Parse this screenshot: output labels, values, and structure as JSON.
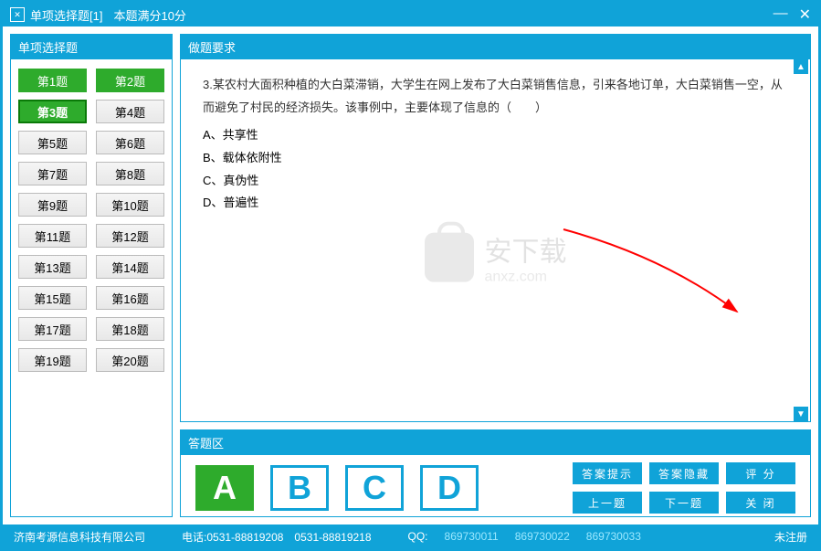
{
  "window": {
    "title": "单项选择题[1]",
    "score_label": "本题满分10分"
  },
  "sidebar": {
    "header": "单项选择题",
    "questions": [
      {
        "label": "第1题",
        "state": "done"
      },
      {
        "label": "第2题",
        "state": "done"
      },
      {
        "label": "第3题",
        "state": "current"
      },
      {
        "label": "第4题",
        "state": ""
      },
      {
        "label": "第5题",
        "state": ""
      },
      {
        "label": "第6题",
        "state": ""
      },
      {
        "label": "第7题",
        "state": ""
      },
      {
        "label": "第8题",
        "state": ""
      },
      {
        "label": "第9题",
        "state": ""
      },
      {
        "label": "第10题",
        "state": ""
      },
      {
        "label": "第11题",
        "state": ""
      },
      {
        "label": "第12题",
        "state": ""
      },
      {
        "label": "第13题",
        "state": ""
      },
      {
        "label": "第14题",
        "state": ""
      },
      {
        "label": "第15题",
        "state": ""
      },
      {
        "label": "第16题",
        "state": ""
      },
      {
        "label": "第17题",
        "state": ""
      },
      {
        "label": "第18题",
        "state": ""
      },
      {
        "label": "第19题",
        "state": ""
      },
      {
        "label": "第20题",
        "state": ""
      }
    ]
  },
  "question": {
    "header": "做题要求",
    "text": "3.某农村大面积种植的大白菜滞销，大学生在网上发布了大白菜销售信息，引来各地订单，大白菜销售一空，从而避免了村民的经济损失。该事例中，主要体现了信息的（　　）",
    "options": {
      "A": "A、共享性",
      "B": "B、载体依附性",
      "C": "C、真伪性",
      "D": "D、普遍性"
    }
  },
  "watermark": {
    "main": "安下载",
    "sub": "anxz.com"
  },
  "answer": {
    "header": "答题区",
    "choices": [
      "A",
      "B",
      "C",
      "D"
    ],
    "selected": "A",
    "actions": {
      "hint": "答案提示",
      "hide": "答案隐藏",
      "score": "评 分",
      "prev": "上一题",
      "next": "下一题",
      "close": "关 闭"
    }
  },
  "statusbar": {
    "company": "济南考源信息科技有限公司",
    "phone": "电话:0531-88819208　0531-88819218",
    "qq_label": "QQ:",
    "qqs": [
      "869730011",
      "869730022",
      "869730033"
    ],
    "reg": "未注册"
  }
}
